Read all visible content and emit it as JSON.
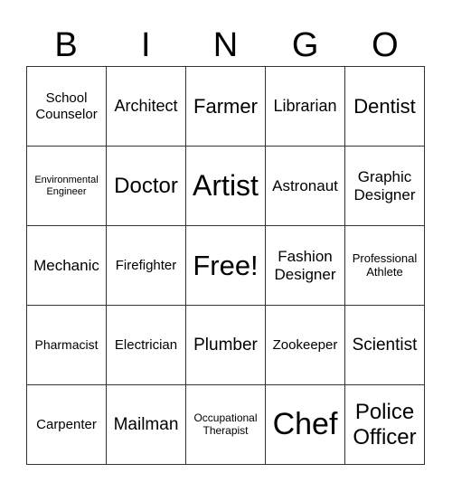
{
  "header": {
    "letters": [
      "B",
      "I",
      "N",
      "G",
      "O"
    ]
  },
  "board": {
    "rows": [
      [
        "School Counselor",
        "Architect",
        "Farmer",
        "Librarian",
        "Dentist"
      ],
      [
        "Environmental Engineer",
        "Doctor",
        "Artist",
        "Astronaut",
        "Graphic Designer"
      ],
      [
        "Mechanic",
        "Firefighter",
        "Free!",
        "Fashion Designer",
        "Professional Athlete"
      ],
      [
        "Pharmacist",
        "Electrician",
        "Plumber",
        "Zookeeper",
        "Scientist"
      ],
      [
        "Carpenter",
        "Mailman",
        "Occupational Therapist",
        "Chef",
        "Police Officer"
      ]
    ]
  },
  "colors": {
    "text": "#000000",
    "grid_line": "#333333",
    "background": "#ffffff"
  }
}
